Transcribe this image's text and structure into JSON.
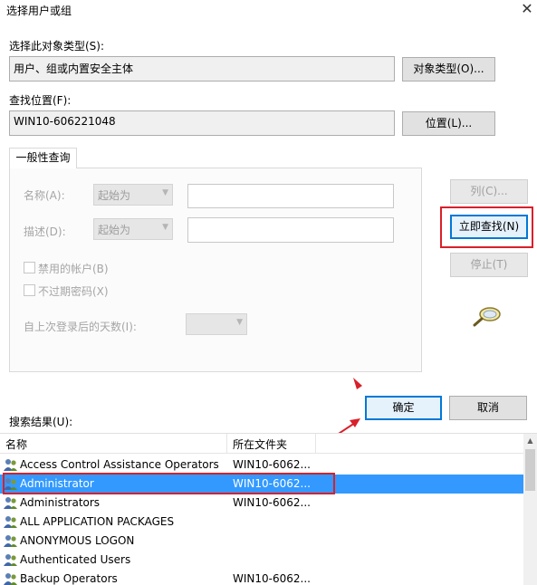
{
  "window": {
    "title": "选择用户或组",
    "close_glyph": "✕"
  },
  "object_type": {
    "label": "选择此对象类型(S):",
    "value": "用户、组或内置安全主体",
    "button": "对象类型(O)..."
  },
  "location": {
    "label": "查找位置(F):",
    "value": "WIN10-606221048",
    "button": "位置(L)..."
  },
  "tab": {
    "label": "一般性查询"
  },
  "query": {
    "name_label": "名称(A):",
    "name_mode": "起始为",
    "desc_label": "描述(D):",
    "desc_mode": "起始为",
    "disabled_accounts": "禁用的帐户(B)",
    "no_expire_pwd": "不过期密码(X)",
    "days_label": "自上次登录后的天数(I):"
  },
  "buttons": {
    "columns": "列(C)...",
    "find_now": "立即查找(N)",
    "stop": "停止(T)",
    "ok": "确定",
    "cancel": "取消"
  },
  "results": {
    "label": "搜索结果(U):",
    "columns": [
      "名称",
      "所在文件夹"
    ],
    "rows": [
      {
        "name": "Access Control Assistance Operators",
        "folder": "WIN10-6062..."
      },
      {
        "name": "Administrator",
        "folder": "WIN10-6062...",
        "selected": true
      },
      {
        "name": "Administrators",
        "folder": "WIN10-6062..."
      },
      {
        "name": "ALL APPLICATION PACKAGES",
        "folder": ""
      },
      {
        "name": "ANONYMOUS LOGON",
        "folder": ""
      },
      {
        "name": "Authenticated Users",
        "folder": ""
      },
      {
        "name": "Backup Operators",
        "folder": "WIN10-6062..."
      }
    ]
  },
  "colors": {
    "annotation_red": "#d9202a",
    "selection_blue": "#3399ff",
    "focus_blue": "#0078d7"
  },
  "icons": {
    "find": "magnifier-icon",
    "user": "user-group-icon",
    "scroll_up": "chevron-up-icon"
  }
}
